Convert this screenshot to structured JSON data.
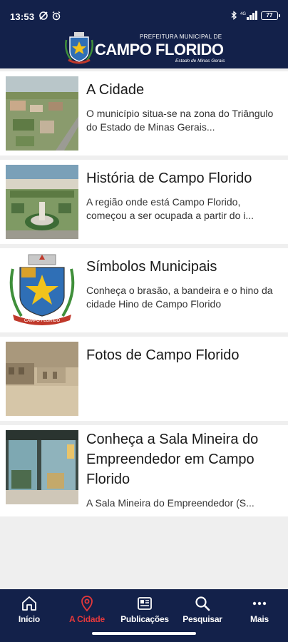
{
  "status_bar": {
    "time": "13:53",
    "battery": "77"
  },
  "header": {
    "brand_small": "PREFEITURA MUNICIPAL DE",
    "brand_name": "CAMPO FLORIDO",
    "brand_sub": "Estado de Minas Gerais"
  },
  "articles": [
    {
      "title": "A Cidade",
      "description": "O município situa-se na zona do Triângulo do Estado de Minas Gerais..."
    },
    {
      "title": "História de Campo Florido",
      "description": "A região onde está Campo Florido, começou a ser ocupada a partir do i..."
    },
    {
      "title": "Símbolos Municipais",
      "description": "Conheça o brasão, a bandeira e o hino da cidade Hino de Campo Florido"
    },
    {
      "title": "Fotos de Campo Florido",
      "description": ""
    },
    {
      "title": "Conheça a Sala Mineira do Empreendedor em Campo Florido",
      "description": "A Sala Mineira do Empreendedor (S..."
    }
  ],
  "crest_banner": "CAMPO FLORIDO",
  "bottom_nav": [
    {
      "label": "Início",
      "icon": "home-icon"
    },
    {
      "label": "A Cidade",
      "icon": "location-pin-icon",
      "active": true
    },
    {
      "label": "Publicações",
      "icon": "newspaper-icon"
    },
    {
      "label": "Pesquisar",
      "icon": "search-icon"
    },
    {
      "label": "Mais",
      "icon": "more-dots-icon"
    }
  ],
  "colors": {
    "header_bg": "#13214a",
    "active_nav": "#e5383b",
    "page_bg": "#efefef"
  }
}
